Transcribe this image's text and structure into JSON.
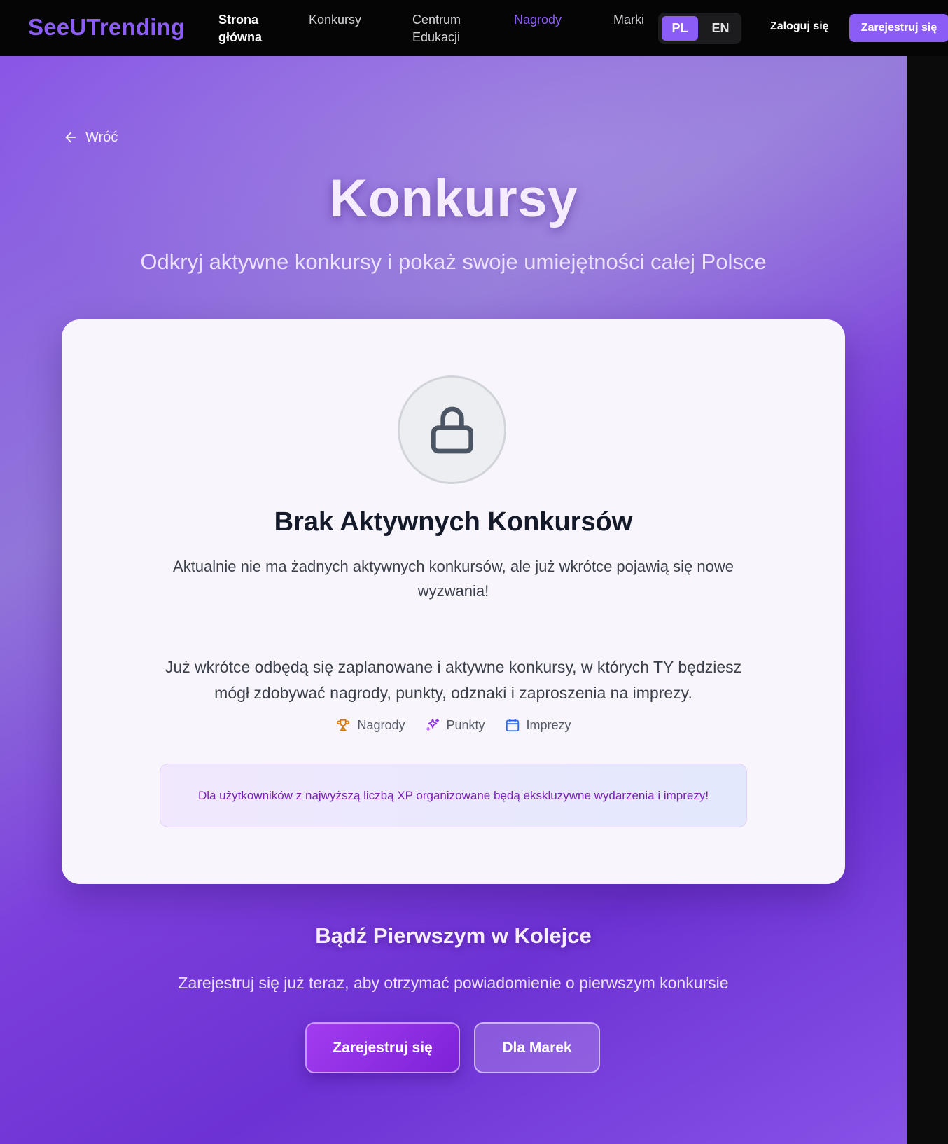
{
  "navbar": {
    "logo": "SeeUTrending",
    "links": [
      {
        "label_line1": "Strona",
        "label_line2": "główna"
      },
      {
        "label": "Konkursy"
      },
      {
        "label_line1": "Centrum",
        "label_line2": "Edukacji"
      },
      {
        "label": "Nagrody"
      },
      {
        "label": "Marki"
      }
    ],
    "lang": {
      "pl": "PL",
      "en": "EN",
      "selected": "PL"
    },
    "login": "Zaloguj się",
    "register": "Zarejestruj się"
  },
  "page": {
    "back": "Wróć",
    "title": "Konkursy",
    "subtitle": "Odkryj aktywne konkursy i pokaż swoje umiejętności całej Polsce"
  },
  "card": {
    "icon": "lock-icon",
    "title": "Brak Aktywnych Konkursów",
    "description": "Aktualnie nie ma żadnych aktywnych konkursów, ale już wkrótce pojawią się nowe wyzwania!",
    "info": "Już wkrótce odbędą się zaplanowane i aktywne konkursy, w których TY będziesz mógł zdobywać nagrody, punkty, odznaki i zaproszenia na imprezy.",
    "features": [
      {
        "icon": "trophy-icon",
        "label": "Nagrody"
      },
      {
        "icon": "sparkles-icon",
        "label": "Punkty"
      },
      {
        "icon": "calendar-icon",
        "label": "Imprezy"
      }
    ],
    "note": "Dla użytkowników z najwyższą liczbą XP organizowane będą ekskluzywne wydarzenia i imprezy!"
  },
  "cta": {
    "title": "Bądź Pierwszym w Kolejce",
    "subtitle": "Zarejestruj się już teraz, aby otrzymać powiadomienie o pierwszym konkursie",
    "register": "Zarejestruj się",
    "brands": "Dla Marek"
  },
  "colors": {
    "brand": "#8b5cf6",
    "navbar_bg": "#050505",
    "card_bg": "#f8f6fc",
    "title_dark": "#141a2a",
    "note_text": "#7a22b8"
  }
}
